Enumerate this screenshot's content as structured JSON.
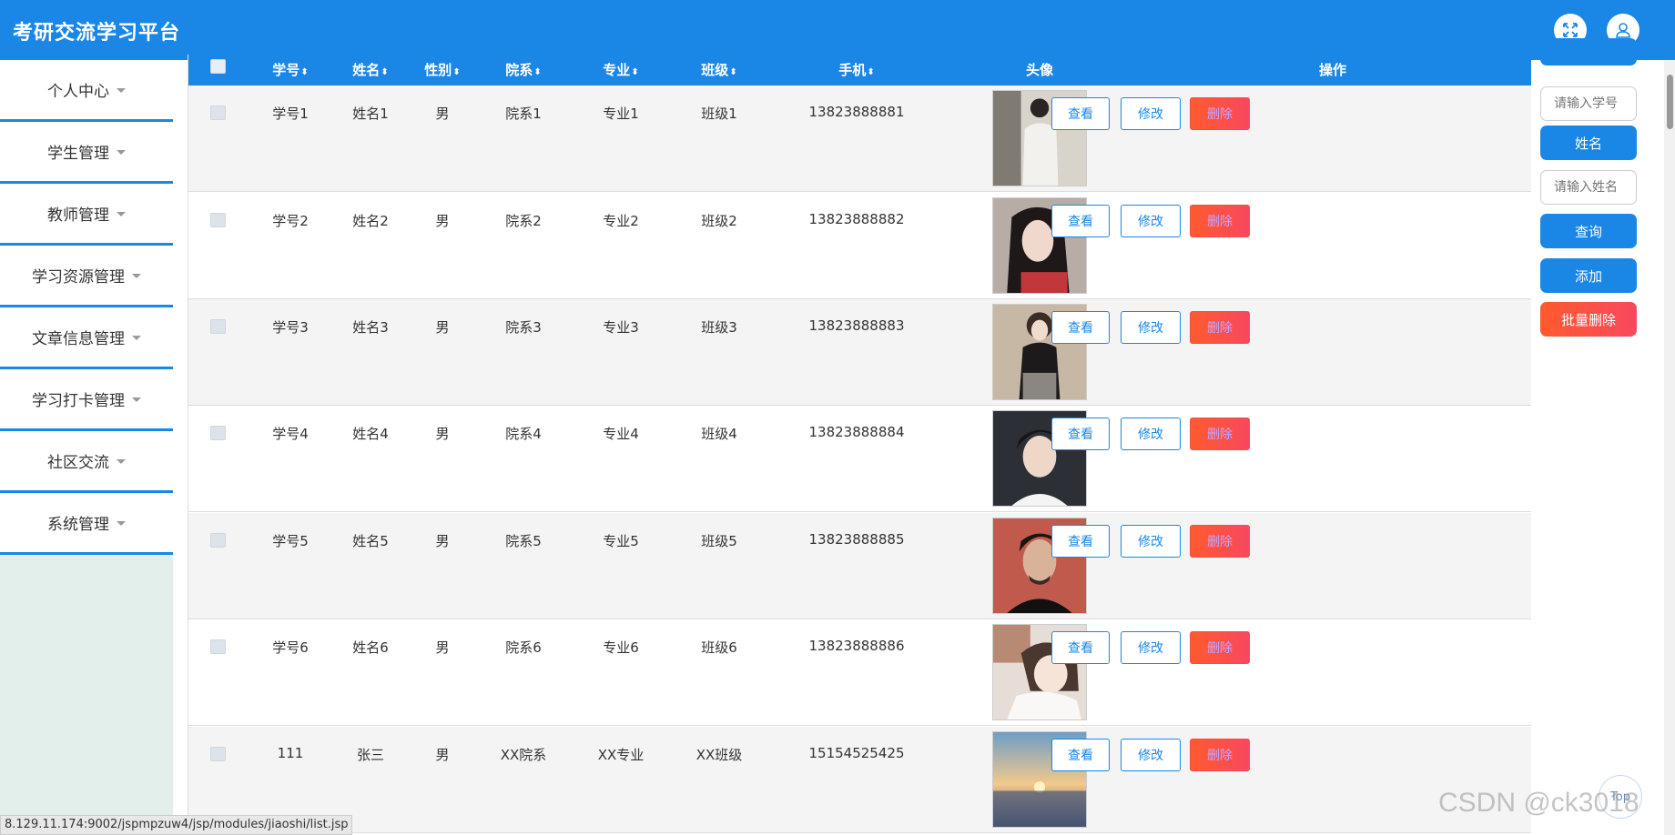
{
  "app": {
    "title": "考研交流学习平台"
  },
  "header": {
    "fullscreen_icon": "fullscreen-icon",
    "user_icon": "user-icon"
  },
  "sidebar": {
    "items": [
      {
        "label": "个人中心"
      },
      {
        "label": "学生管理"
      },
      {
        "label": "教师管理"
      },
      {
        "label": "学习资源管理"
      },
      {
        "label": "文章信息管理"
      },
      {
        "label": "学习打卡管理"
      },
      {
        "label": "社区交流"
      },
      {
        "label": "系统管理"
      }
    ]
  },
  "table": {
    "columns": [
      "学号",
      "姓名",
      "性别",
      "院系",
      "专业",
      "班级",
      "手机",
      "头像",
      "操作"
    ],
    "actions": {
      "view": "查看",
      "edit": "修改",
      "delete": "删除"
    },
    "rows": [
      {
        "id": "学号1",
        "name": "姓名1",
        "gender": "男",
        "dept": "院系1",
        "major": "专业1",
        "class": "班级1",
        "phone": "13823888881"
      },
      {
        "id": "学号2",
        "name": "姓名2",
        "gender": "男",
        "dept": "院系2",
        "major": "专业2",
        "class": "班级2",
        "phone": "13823888882"
      },
      {
        "id": "学号3",
        "name": "姓名3",
        "gender": "男",
        "dept": "院系3",
        "major": "专业3",
        "class": "班级3",
        "phone": "13823888883"
      },
      {
        "id": "学号4",
        "name": "姓名4",
        "gender": "男",
        "dept": "院系4",
        "major": "专业4",
        "class": "班级4",
        "phone": "13823888884"
      },
      {
        "id": "学号5",
        "name": "姓名5",
        "gender": "男",
        "dept": "院系5",
        "major": "专业5",
        "class": "班级5",
        "phone": "13823888885"
      },
      {
        "id": "学号6",
        "name": "姓名6",
        "gender": "男",
        "dept": "院系6",
        "major": "专业6",
        "class": "班级6",
        "phone": "13823888886"
      },
      {
        "id": "111",
        "name": "张三",
        "gender": "男",
        "dept": "XX院系",
        "major": "XX专业",
        "class": "XX班级",
        "phone": "15154525425"
      }
    ]
  },
  "search": {
    "id_placeholder": "请输入学号",
    "name_label": "姓名",
    "name_placeholder": "请输入姓名",
    "query_label": "查询",
    "add_label": "添加",
    "batch_delete_label": "批量删除"
  },
  "colors": {
    "primary": "#1a87e6",
    "danger": "#f8485f",
    "sidebar_bg": "#e3efea"
  },
  "status_url": "8.129.11.174:9002/jspmpzuw4/jsp/modules/jiaoshi/list.jsp",
  "watermark": "CSDN @ck3018",
  "back_to_top": "Top"
}
